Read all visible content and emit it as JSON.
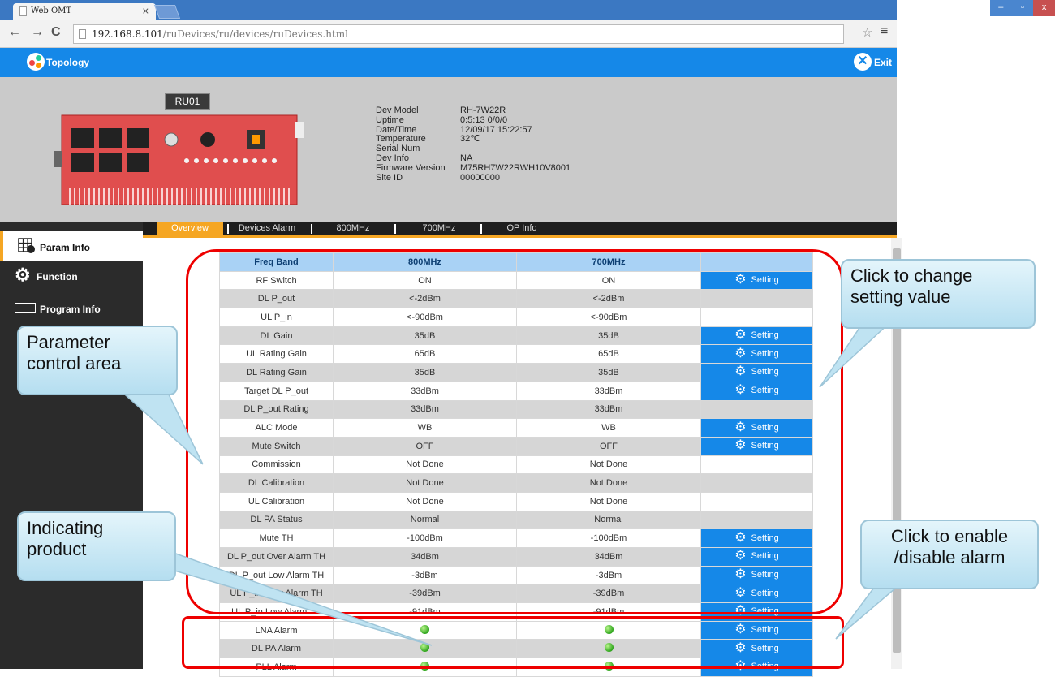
{
  "browser": {
    "tab_title": "Web OMT",
    "tab_close": "×",
    "url_host": "192.168.8.101",
    "url_path": "/ruDevices/ru/devices/ruDevices.html",
    "window_controls": [
      "–",
      "▫",
      "x"
    ]
  },
  "app_header": {
    "topology_label": "Topology",
    "exit_label": "Exit"
  },
  "device": {
    "tag": "RU01",
    "info": [
      {
        "key": "Dev Model",
        "value": "RH-7W22R"
      },
      {
        "key": "Uptime",
        "value": "0:5:13 0/0/0"
      },
      {
        "key": "Date/Time",
        "value": "12/09/17 15:22:57"
      },
      {
        "key": "Temperature",
        "value": "32℃"
      },
      {
        "key": "Serial Num",
        "value": ""
      },
      {
        "key": "Dev Info",
        "value": "NA"
      },
      {
        "key": "Firmware Version",
        "value": "M75RH7W22RWH10V8001"
      },
      {
        "key": "Site ID",
        "value": "00000000"
      }
    ]
  },
  "tabs": [
    "Overview",
    "Devices Alarm",
    "800MHz",
    "700MHz",
    "OP Info"
  ],
  "sidebar": [
    {
      "label": "Param Info",
      "icon": "grid-gear-icon"
    },
    {
      "label": "Function",
      "icon": "gear-icon"
    },
    {
      "label": "Program Info",
      "icon": "window-icon"
    }
  ],
  "table": {
    "headers": [
      "Freq Band",
      "800MHz",
      "700MHz",
      ""
    ],
    "setting_label": "Setting",
    "rows": [
      {
        "name": "RF Switch",
        "v1": "ON",
        "v2": "ON",
        "setting": true
      },
      {
        "name": "DL P_out",
        "v1": "<-2dBm",
        "v2": "<-2dBm",
        "setting": false
      },
      {
        "name": "UL P_in",
        "v1": "<-90dBm",
        "v2": "<-90dBm",
        "setting": false
      },
      {
        "name": "DL Gain",
        "v1": "35dB",
        "v2": "35dB",
        "setting": true
      },
      {
        "name": "UL Rating Gain",
        "v1": "65dB",
        "v2": "65dB",
        "setting": true
      },
      {
        "name": "DL Rating Gain",
        "v1": "35dB",
        "v2": "35dB",
        "setting": true
      },
      {
        "name": "Target DL P_out",
        "v1": "33dBm",
        "v2": "33dBm",
        "setting": true
      },
      {
        "name": "DL P_out Rating",
        "v1": "33dBm",
        "v2": "33dBm",
        "setting": false
      },
      {
        "name": "ALC Mode",
        "v1": "WB",
        "v2": "WB",
        "setting": true
      },
      {
        "name": "Mute Switch",
        "v1": "OFF",
        "v2": "OFF",
        "setting": true
      },
      {
        "name": "Commission",
        "v1": "Not Done",
        "v2": "Not Done",
        "setting": false
      },
      {
        "name": "DL Calibration",
        "v1": "Not Done",
        "v2": "Not Done",
        "setting": false
      },
      {
        "name": "UL Calibration",
        "v1": "Not Done",
        "v2": "Not Done",
        "setting": false
      },
      {
        "name": "DL PA Status",
        "v1": "Normal",
        "v2": "Normal",
        "setting": false
      },
      {
        "name": "Mute TH",
        "v1": "-100dBm",
        "v2": "-100dBm",
        "setting": true
      },
      {
        "name": "DL P_out Over Alarm TH",
        "v1": "34dBm",
        "v2": "34dBm",
        "setting": true
      },
      {
        "name": "DL P_out Low Alarm TH",
        "v1": "-3dBm",
        "v2": "-3dBm",
        "setting": true
      },
      {
        "name": "UL P_in Over Alarm TH",
        "v1": "-39dBm",
        "v2": "-39dBm",
        "setting": true
      },
      {
        "name": "UL P_in Low Alarm TH",
        "v1": "-91dBm",
        "v2": "-91dBm",
        "setting": true
      }
    ],
    "alarm_rows": [
      {
        "name": "LNA Alarm",
        "status1": "ok",
        "status2": "ok"
      },
      {
        "name": "DL PA Alarm",
        "status1": "ok",
        "status2": "ok"
      },
      {
        "name": "PLL Alarm",
        "status1": "ok",
        "status2": "ok"
      }
    ]
  },
  "annotations": {
    "parameter_area": "Parameter control area",
    "change_setting": "Click to change setting value",
    "indicating": "Indicating product",
    "enable_alarm": "Click to enable /disable alarm"
  },
  "colors": {
    "accent": "#1588e8",
    "orange": "#f5a623",
    "alarm_border": "#ee0000"
  }
}
